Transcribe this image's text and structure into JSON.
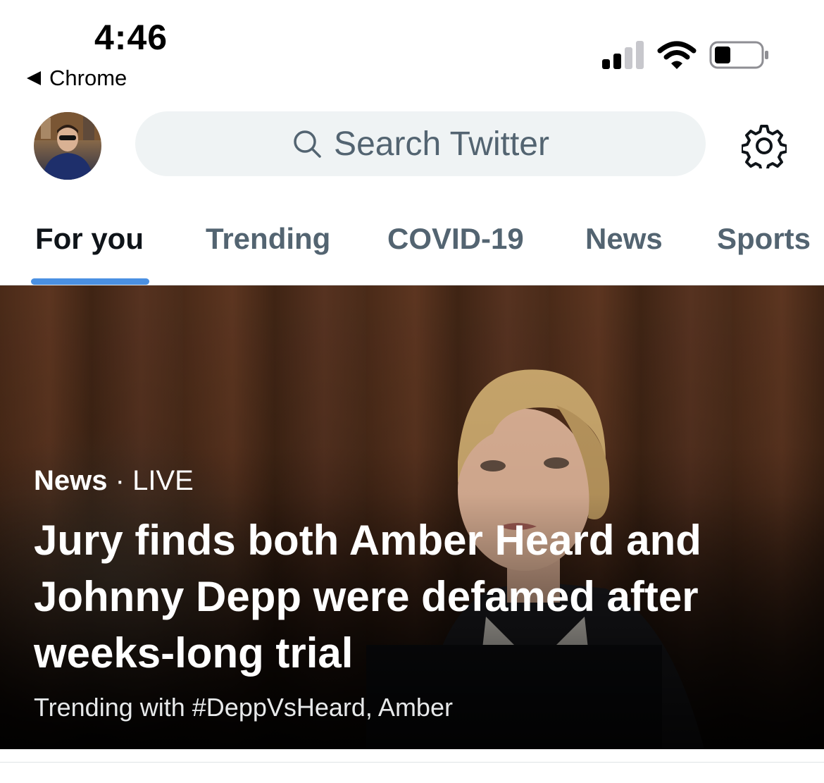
{
  "status_bar": {
    "time": "4:46",
    "back_app": "Chrome",
    "battery_level": 0.35
  },
  "header": {
    "search_placeholder": "Search Twitter"
  },
  "tabs": [
    {
      "label": "For you",
      "active": true
    },
    {
      "label": "Trending",
      "active": false
    },
    {
      "label": "COVID-19",
      "active": false
    },
    {
      "label": "News",
      "active": false
    },
    {
      "label": "Sports",
      "active": false
    }
  ],
  "hero": {
    "category": "News",
    "separator": "·",
    "status": "LIVE",
    "headline": "Jury finds both Amber Heard and Johnny Depp were defamed after weeks-long trial",
    "trending": "Trending with #DeppVsHeard, Amber"
  },
  "colors": {
    "accent": "#4a90e2",
    "text_primary": "#0f1419",
    "text_secondary": "#536471",
    "search_bg": "#eff3f4"
  },
  "icons": [
    "back-arrow-icon",
    "signal-icon",
    "wifi-icon",
    "battery-icon",
    "search-icon",
    "gear-icon"
  ]
}
